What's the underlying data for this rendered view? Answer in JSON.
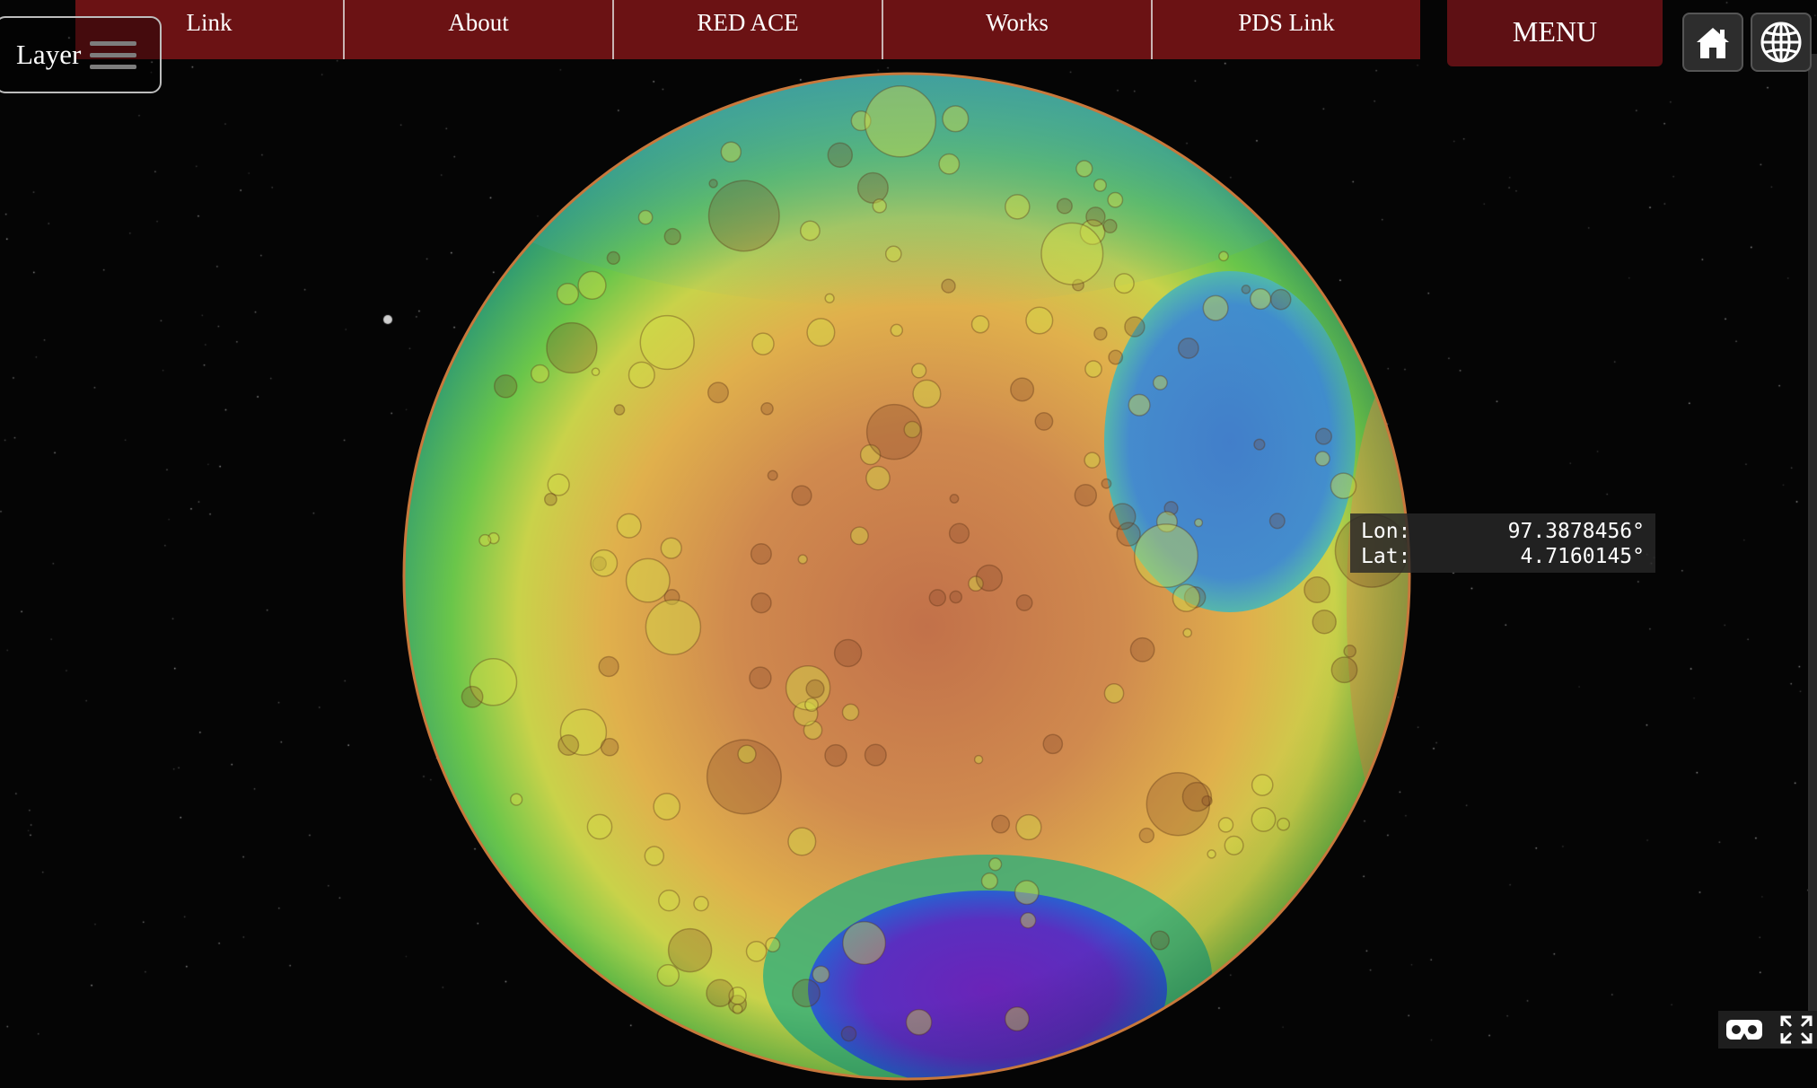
{
  "nav": {
    "items": [
      {
        "label": "Link"
      },
      {
        "label": "About"
      },
      {
        "label": "RED ACE"
      },
      {
        "label": "Works"
      },
      {
        "label": "PDS Link"
      }
    ],
    "menu_label": "MENU"
  },
  "layer": {
    "label": "Layer"
  },
  "icons": {
    "home": "home-icon",
    "globe": "globe-icon",
    "menu": "hamburger-icon",
    "vr": "vr-headset-icon",
    "fullscreen": "fullscreen-icon"
  },
  "coordinates": {
    "lon_label": "Lon:",
    "lon_value": "97.3878456°",
    "lat_label": "Lat:",
    "lat_value": "4.7160145°"
  },
  "colors": {
    "nav_bg": "#6b1214",
    "menu_bg": "#5e1014",
    "space_bg": "#050505"
  }
}
